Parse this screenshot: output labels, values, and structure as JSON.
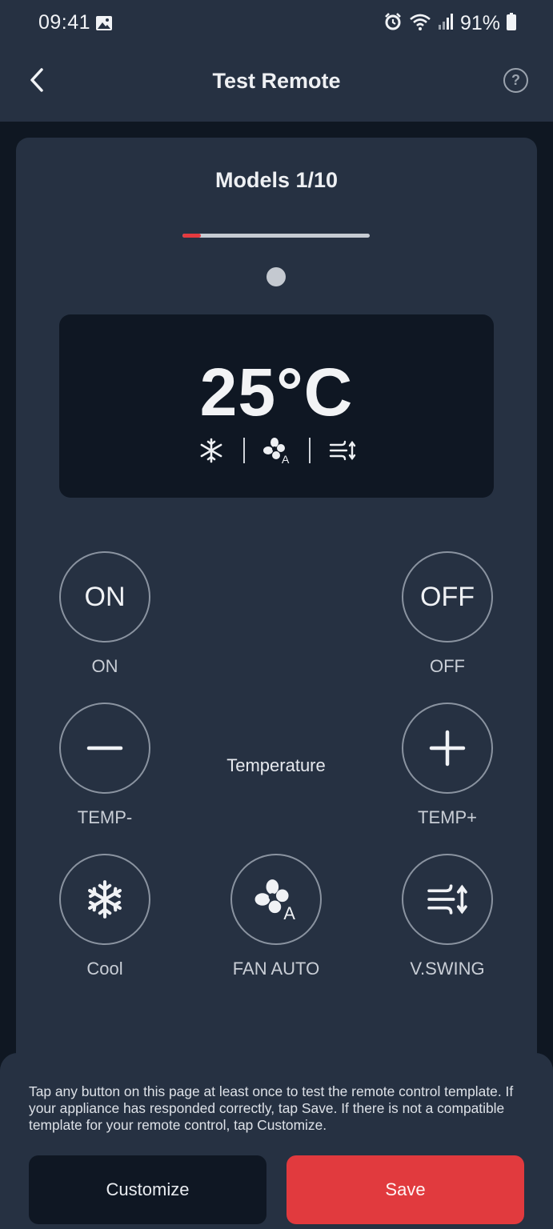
{
  "status_bar": {
    "time": "09:41",
    "battery": "91%",
    "icons": [
      "gallery-icon",
      "alarm-icon",
      "wifi-icon",
      "signal-icon",
      "battery-icon"
    ]
  },
  "header": {
    "title": "Test Remote",
    "back_icon": "chevron-left-icon",
    "help_icon": "help-circle-icon",
    "help_glyph": "?"
  },
  "models": {
    "label": "Models 1/10",
    "current": 1,
    "total": 10,
    "progress_fraction": 0.1
  },
  "display": {
    "temperature": "25°C",
    "mode_icons": [
      "snowflake-icon",
      "fan-auto-icon",
      "vertical-swing-icon"
    ]
  },
  "buttons": {
    "on": {
      "text": "ON",
      "label": "ON"
    },
    "off": {
      "text": "OFF",
      "label": "OFF"
    },
    "temp_minus": {
      "label": "TEMP-"
    },
    "temp_plus": {
      "label": "TEMP+"
    },
    "temperature_label": "Temperature",
    "cool": {
      "label": "Cool"
    },
    "fan_auto": {
      "label": "FAN AUTO"
    },
    "v_swing": {
      "label": "V.SWING"
    }
  },
  "footer": {
    "notice": "Tap any button on this page at least once to test the remote control template. If your appliance has responded correctly, tap Save. If there is not a compatible template for your remote control, tap Customize.",
    "customize_label": "Customize",
    "save_label": "Save"
  },
  "colors": {
    "background": "#0f1722",
    "surface": "#263142",
    "accent": "#e13a3e",
    "display": "#0f1723"
  }
}
